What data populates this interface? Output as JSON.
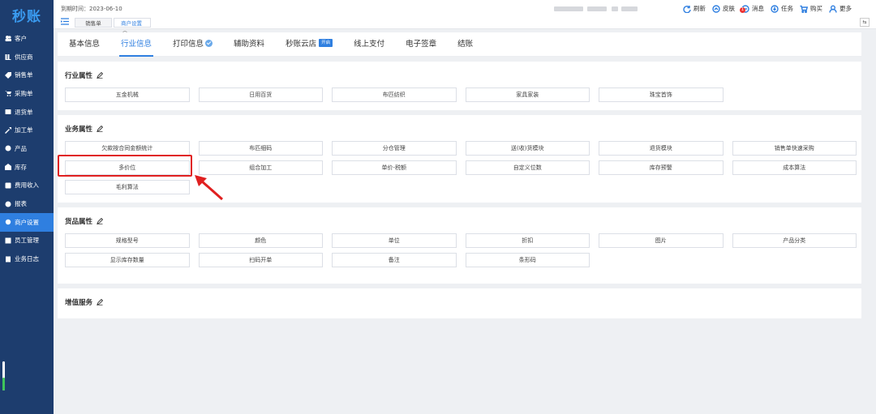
{
  "app": {
    "logo": "秒账"
  },
  "sidebar": {
    "items": [
      {
        "label": "客户",
        "icon": "users-icon"
      },
      {
        "label": "供应商",
        "icon": "supplier-icon"
      },
      {
        "label": "销售单",
        "icon": "tag-icon"
      },
      {
        "label": "采购单",
        "icon": "cart-icon"
      },
      {
        "label": "退货单",
        "icon": "return-icon"
      },
      {
        "label": "加工单",
        "icon": "tool-icon"
      },
      {
        "label": "产品",
        "icon": "product-icon"
      },
      {
        "label": "库存",
        "icon": "warehouse-icon"
      },
      {
        "label": "费用收入",
        "icon": "expense-icon"
      },
      {
        "label": "报表",
        "icon": "chart-icon"
      },
      {
        "label": "商户设置",
        "icon": "gear-icon",
        "active": true
      },
      {
        "label": "员工管理",
        "icon": "staff-icon"
      },
      {
        "label": "业务日志",
        "icon": "log-icon"
      }
    ],
    "meter_fraction": 0.45
  },
  "header": {
    "expire_text": "到期时间：2023-06-10",
    "open_tabs": [
      "销售单",
      "商户设置"
    ],
    "tools": [
      {
        "label": "刷新",
        "icon": "refresh-icon"
      },
      {
        "label": "皮肤",
        "icon": "skin-icon"
      },
      {
        "label": "消息",
        "icon": "message-icon",
        "badge": "1"
      },
      {
        "label": "任务",
        "icon": "task-icon"
      },
      {
        "label": "购买",
        "icon": "cart-icon"
      },
      {
        "label": "更多",
        "icon": "user-icon"
      }
    ]
  },
  "tabs": [
    {
      "label": "基本信息"
    },
    {
      "label": "行业信息",
      "active": true
    },
    {
      "label": "打印信息"
    },
    {
      "label": "辅助资料"
    },
    {
      "label": "秒账云店",
      "tag": "开启"
    },
    {
      "label": "线上支付"
    },
    {
      "label": "电子签章"
    },
    {
      "label": "结账"
    }
  ],
  "sections": [
    {
      "title": "行业属性",
      "options": [
        "五金机械",
        "日用百货",
        "布匹纺织",
        "家具家装",
        "珠宝首饰"
      ]
    },
    {
      "title": "业务属性",
      "options": [
        "欠款按合同金额统计",
        "布匹细码",
        "分仓管理",
        "送(收)货模块",
        "退货模块",
        "销售单快速采购",
        "多价位",
        "组合加工",
        "单价-税额",
        "自定义位数",
        "库存预警",
        "成本算法",
        "毛利算法"
      ]
    },
    {
      "title": "货品属性",
      "options": [
        "规格型号",
        "颜色",
        "单位",
        "折扣",
        "图片",
        "产品分类",
        "显示库存数量",
        "扫码开单",
        "备注",
        "条形码"
      ]
    },
    {
      "title": "增值服务",
      "options": []
    }
  ]
}
